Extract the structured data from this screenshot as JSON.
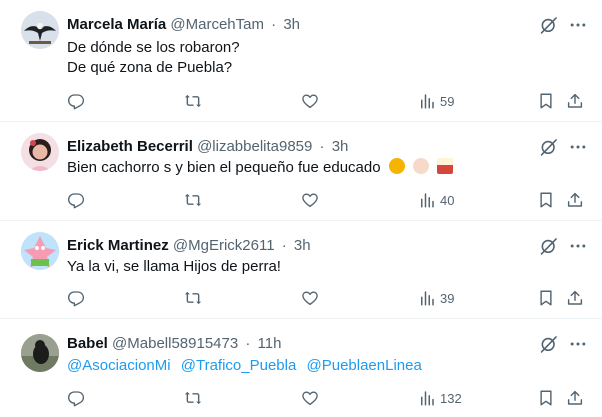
{
  "tweets": [
    {
      "name": "Marcela María",
      "handle": "@MarcehTam",
      "separator": "·",
      "time": "3h",
      "lines": [
        "De dónde se los robaron?",
        "De qué zona de Puebla?"
      ],
      "views": "59"
    },
    {
      "name": "Elizabeth Becerril",
      "handle": "@lizabbelita9859",
      "separator": "·",
      "time": "3h",
      "lines": [
        "Bien cachorro s y bien el pequeño fue educado"
      ],
      "emojis": [
        "shushing-face",
        "clapping-hands",
        "popcorn"
      ],
      "views": "40"
    },
    {
      "name": "Erick Martinez",
      "handle": "@MgErick2611",
      "separator": "·",
      "time": "3h",
      "lines": [
        "Ya la vi, se llama Hijos de perra!"
      ],
      "views": "39"
    },
    {
      "name": "Babel",
      "handle": "@Mabell58915473",
      "separator": "·",
      "time": "11h",
      "mentions": [
        "@AsociacionMi",
        "@Trafico_Puebla",
        "@PueblaenLinea"
      ],
      "views": "132"
    }
  ],
  "colors": {
    "text": "#0f1419",
    "secondary": "#536471",
    "link": "#1d9bf0",
    "divider": "#eff3f4"
  },
  "icons": [
    "reply-icon",
    "retweet-icon",
    "like-icon",
    "views-icon",
    "bookmark-icon",
    "share-icon",
    "grok-icon",
    "more-icon"
  ]
}
